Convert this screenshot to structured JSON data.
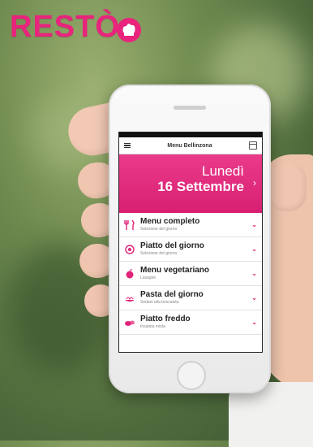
{
  "brand": {
    "logo_text": "RESTÒ",
    "accent_color": "#e8247d"
  },
  "app": {
    "header_title": "Menu Bellinzona",
    "menu_icon": "hamburger-icon",
    "calendar_icon": "calendar-icon",
    "day_name": "Lunedì",
    "date": "16 Settembre",
    "next_icon": "chevron-right-icon",
    "items": [
      {
        "title": "Menu completo",
        "subtitle": "Selezione del giorno",
        "icon": "cutlery-icon"
      },
      {
        "title": "Piatto del giorno",
        "subtitle": "Selezione del giorno",
        "icon": "plate-icon"
      },
      {
        "title": "Menu vegetariano",
        "subtitle": "Lasagne",
        "icon": "apple-icon"
      },
      {
        "title": "Pasta del giorno",
        "subtitle": "Sedani alla boscaiola",
        "icon": "pasta-icon"
      },
      {
        "title": "Piatto freddo",
        "subtitle": "Insalata mista",
        "icon": "salad-icon"
      }
    ]
  }
}
